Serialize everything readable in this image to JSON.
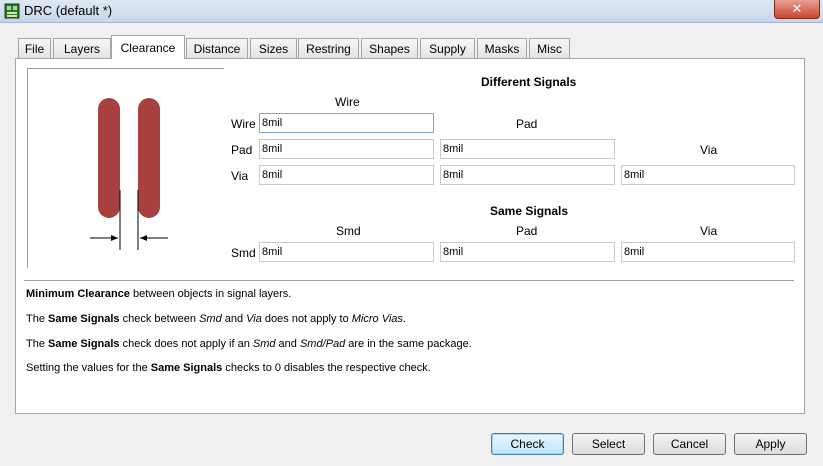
{
  "window": {
    "title": "DRC (default *)",
    "close_glyph": "✕"
  },
  "tabs": [
    {
      "label": "File"
    },
    {
      "label": "Layers"
    },
    {
      "label": "Clearance"
    },
    {
      "label": "Distance"
    },
    {
      "label": "Sizes"
    },
    {
      "label": "Restring"
    },
    {
      "label": "Shapes"
    },
    {
      "label": "Supply"
    },
    {
      "label": "Masks"
    },
    {
      "label": "Misc"
    }
  ],
  "active_tab": "Clearance",
  "colors": {
    "trace": "#a94040",
    "panel_bg": "#ffffff",
    "window_bg": "#f0f0f0"
  },
  "different_signals": {
    "title": "Different Signals",
    "col_wire": "Wire",
    "col_pad": "Pad",
    "col_via": "Via",
    "row_wire": "Wire",
    "row_pad": "Pad",
    "row_via": "Via",
    "wire_wire": "8mil",
    "pad_wire": "8mil",
    "pad_pad": "8mil",
    "via_wire": "8mil",
    "via_pad": "8mil",
    "via_via": "8mil"
  },
  "same_signals": {
    "title": "Same Signals",
    "col_smd": "Smd",
    "col_pad": "Pad",
    "col_via": "Via",
    "row_smd": "Smd",
    "smd_smd": "8mil",
    "smd_pad": "8mil",
    "smd_via": "8mil"
  },
  "info": {
    "line1": {
      "b1": "Minimum Clearance",
      "t1": " between objects in signal layers."
    },
    "line2": {
      "t0": "The ",
      "b1": "Same Signals",
      "t1": " check between ",
      "i1": "Smd",
      "t2": " and ",
      "i2": "Via",
      "t3": " does not apply to ",
      "i3": "Micro Vias",
      "t4": "."
    },
    "line3": {
      "t0": "The ",
      "b1": "Same Signals",
      "t1": " check does not apply if an ",
      "i1": "Smd",
      "t2": " and ",
      "i2": "Smd/Pad",
      "t3": " are in the same package."
    },
    "line4": {
      "t0": "Setting the values for the ",
      "b1": "Same Signals",
      "t1": " checks to 0 disables the respective check."
    }
  },
  "buttons": {
    "check": "Check",
    "select": "Select",
    "cancel": "Cancel",
    "apply": "Apply"
  }
}
